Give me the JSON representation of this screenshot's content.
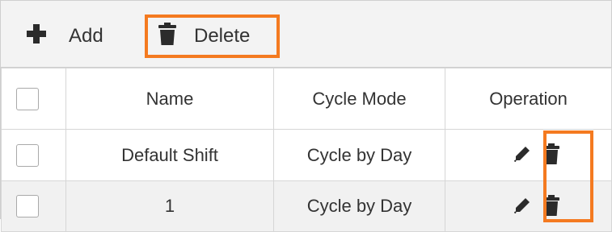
{
  "toolbar": {
    "add_label": "Add",
    "add_icon": "plus-icon",
    "delete_label": "Delete",
    "delete_icon": "trash-icon"
  },
  "table": {
    "columns": [
      "",
      "Name",
      "Cycle Mode",
      "Operation"
    ],
    "rows": [
      {
        "name": "Default Shift",
        "cycle_mode": "Cycle by Day",
        "operations": [
          "pencil-icon",
          "trash-icon"
        ]
      },
      {
        "name": "1",
        "cycle_mode": "Cycle by Day",
        "operations": [
          "pencil-icon",
          "trash-icon"
        ]
      }
    ]
  },
  "colors": {
    "highlight": "#f47a20",
    "toolbar_bg": "#f3f3f3",
    "alt_row_bg": "#f1f1f1",
    "text": "#333333"
  }
}
